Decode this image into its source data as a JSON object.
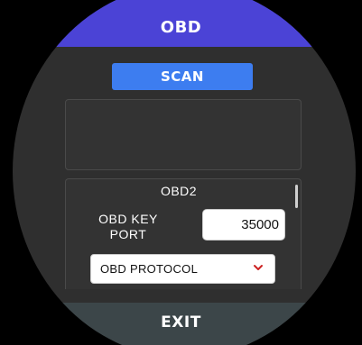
{
  "header": {
    "title": "OBD"
  },
  "scan": {
    "label": "SCAN"
  },
  "result": {
    "text": ""
  },
  "settings": {
    "section_title": "OBD2",
    "port_label": "OBD KEY PORT",
    "port_value": "35000",
    "protocol_label": "OBD PROTOCOL",
    "protocol_icon": "chevron-down-icon"
  },
  "footer": {
    "label": "EXIT"
  },
  "colors": {
    "header": "#4b43d6",
    "scan_button": "#3d7df0",
    "background": "#2f2f2f",
    "footer": "#3c4649",
    "chevron": "#cc2222"
  }
}
